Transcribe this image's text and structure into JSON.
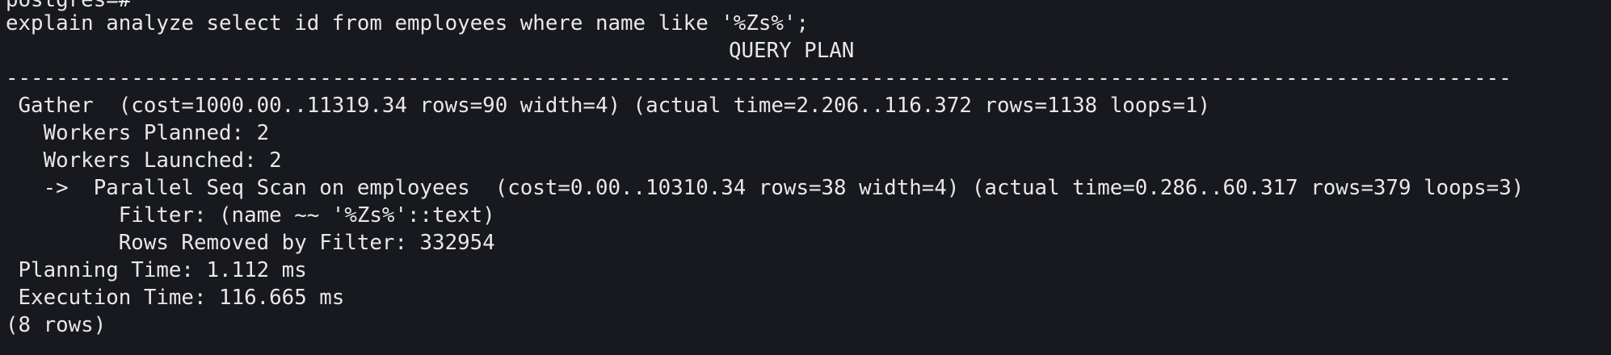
{
  "terminal": {
    "prompt": "postgres=#",
    "command": "explain analyze select id from employees where name like '%Zs%';",
    "column_header": "QUERY PLAN",
    "divider": "------------------------------------------------------------------------------------------------------------------------",
    "plan_lines": [
      " Gather  (cost=1000.00..11319.34 rows=90 width=4) (actual time=2.206..116.372 rows=1138 loops=1)",
      "   Workers Planned: 2",
      "   Workers Launched: 2",
      "   ->  Parallel Seq Scan on employees  (cost=0.00..10310.34 rows=38 width=4) (actual time=0.286..60.317 rows=379 loops=3)",
      "         Filter: (name ~~ '%Zs%'::text)",
      "         Rows Removed by Filter: 332954",
      " Planning Time: 1.112 ms",
      " Execution Time: 116.665 ms"
    ],
    "row_count": "(8 rows)"
  }
}
